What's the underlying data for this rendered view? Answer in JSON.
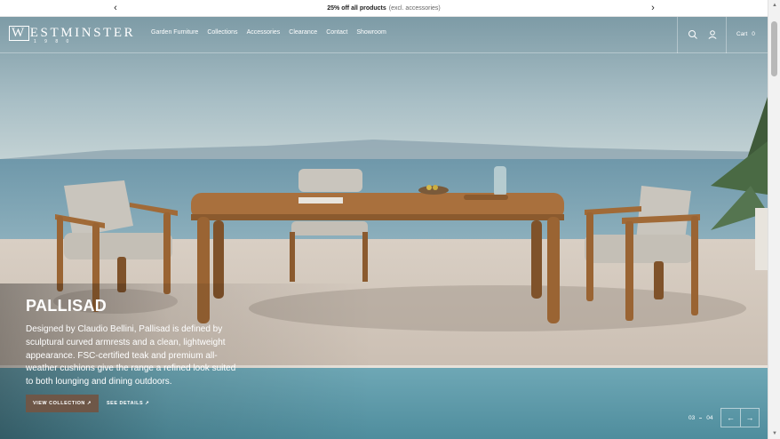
{
  "announcement": {
    "bold_text": "25% off all products",
    "muted_text": "(excl. accessories)",
    "prev_icon": "chevron-left-icon",
    "next_icon": "chevron-right-icon"
  },
  "brand": {
    "name": "ESTMINSTER",
    "initial": "W",
    "year": "1 9 8 0"
  },
  "nav": {
    "items": [
      "Garden Furniture",
      "Collections",
      "Accessories",
      "Clearance",
      "Contact",
      "Showroom"
    ]
  },
  "header": {
    "search_icon": "search-icon",
    "account_icon": "user-icon",
    "cart_label": "Cart",
    "cart_count": "0"
  },
  "hero": {
    "title": "PALLISAD",
    "description": "Designed by Claudio Bellini, Pallisad is defined by sculptural curved armrests and a clean, lightweight appearance. FSC-certified teak and premium all-weather cushions give the range a refined look suited to both lounging and dining outdoors.",
    "primary_button": "VIEW COLLECTION ↗",
    "secondary_link": "SEE DETAILS ↗",
    "accent_color": "#6e5748"
  },
  "slider": {
    "current": "03",
    "total": "04",
    "prev_icon": "arrow-left-icon",
    "next_icon": "arrow-right-icon"
  }
}
